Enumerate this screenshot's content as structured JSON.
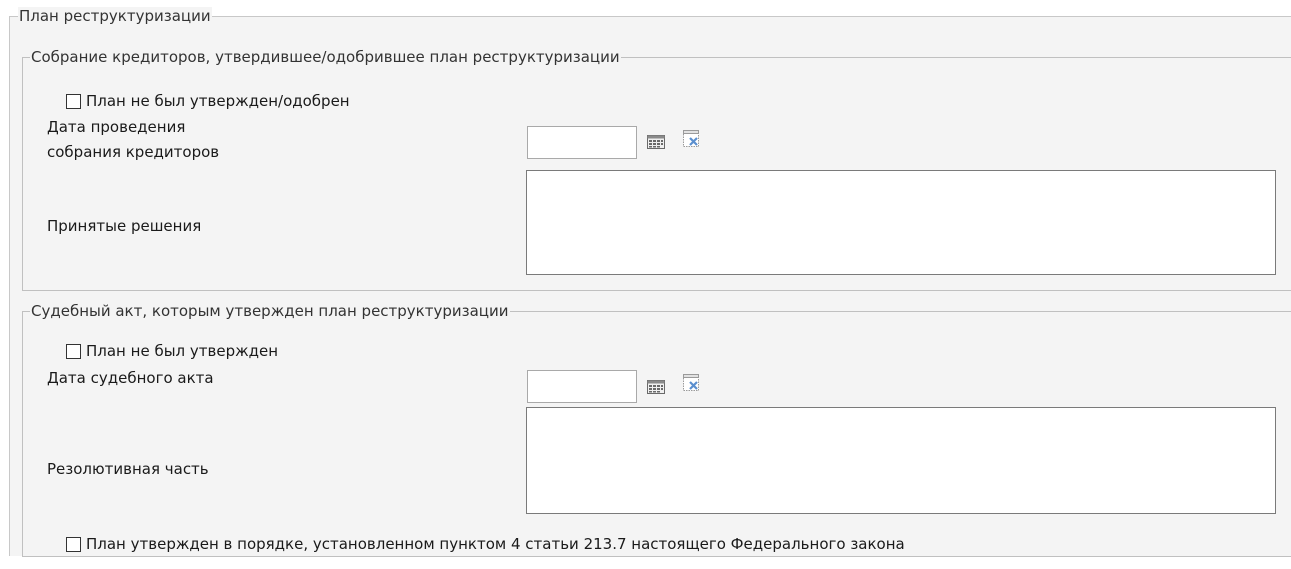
{
  "restructuring_plan": {
    "title": "План реструктуризации",
    "creditors_meeting": {
      "title": "Собрание кредиторов, утвердившее/одобрившее план реструктуризации",
      "not_approved_label": "План не был утвержден/одобрен",
      "not_approved_checked": false,
      "meeting_date_label_line1": "Дата проведения",
      "meeting_date_label_line2": "собрания кредиторов",
      "meeting_date_value": "",
      "decisions_label": "Принятые решения",
      "decisions_value": ""
    },
    "court_act": {
      "title": "Судебный акт, которым утвержден план реструктуризации",
      "not_approved_label": "План не был утвержден",
      "not_approved_checked": false,
      "act_date_label": "Дата судебного акта",
      "act_date_value": "",
      "operative_part_label": "Резолютивная часть",
      "operative_part_value": ""
    },
    "approved_by_law_label": "План утвержден в порядке, установленном пунктом 4 статьи 213.7 настоящего Федерального закона",
    "approved_by_law_checked": false
  },
  "icons": {
    "calendar": "calendar-icon",
    "clear": "clear-date-icon"
  }
}
